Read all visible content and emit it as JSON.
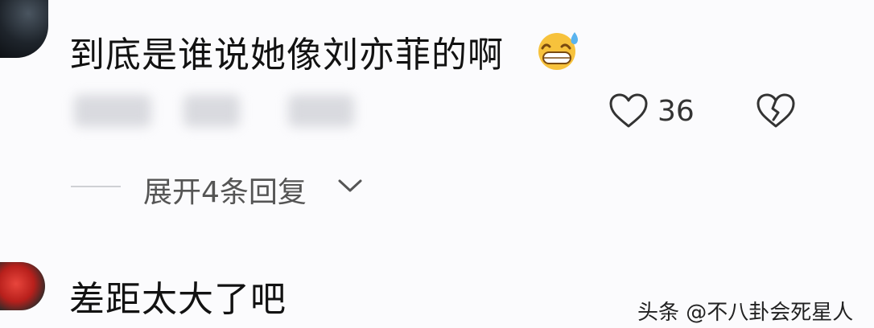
{
  "comments": [
    {
      "text": "到底是谁说她像刘亦菲的啊",
      "emoji": "grinning-sweat-emoji",
      "like_count": "36",
      "expand_replies_label": "展开4条回复"
    },
    {
      "text": "差距太大了吧"
    }
  ],
  "watermark": "头条 @不八卦会死星人",
  "icons": {
    "like": "heart-outline-icon",
    "dislike": "broken-heart-icon",
    "expand": "chevron-down-icon"
  }
}
